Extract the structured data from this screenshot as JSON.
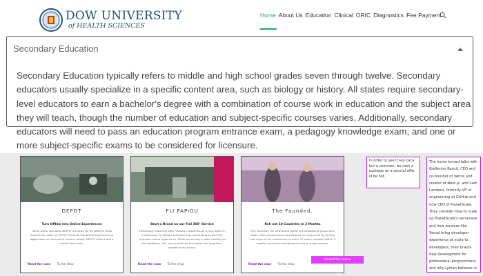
{
  "header": {
    "logo_line1": "DOW UNIVERSITY",
    "logo_line2": "of HEALTH SCIENCES",
    "nav": [
      "Home",
      "About Us",
      "Education",
      "Clinical",
      "ORIC",
      "Diagnostics",
      "Fee Payment"
    ],
    "active_nav": "Home",
    "search_icon": "search-icon",
    "accent_color": "#1aa66a"
  },
  "accordion": {
    "title": "Secondary Education",
    "body": "Secondary Education typically refers to middle and high school grades seven through twelve. Secondary educators usually specialize in a specific content area, such as biology or history. All states require secondary-level educators to earn a bachelor's degree with a combination of course work in education and the subject area they will teach, though the number of education and subject-specific courses varies. Additionally, secondary educators will need to pass an education program entrance exam, a pedagogy knowledge exam, and one or more subject-specific exams to be considered for licensure."
  },
  "cards": [
    {
      "title": "DEPOT",
      "subtitle": "Turn Offline into Online Experiences",
      "description": "Home decor specialist DEPOT is known for its lifestyle retail experience. With us, DEPOT extends this brand experience to digital with an interactive content brand: DEPOT Collect and a unified brand feel.",
      "read": "Read the case",
      "shop": "To the shop"
    },
    {
      "title": "FLI PAPIGU",
      "subtitle": "Start a Brand on our Full 360° Service",
      "description": "Effortlessly matching with multiple customers as a new brand in a saturated. Fli Papigu achieved it by rebranding as with the complete online experience. While increasing a solid visibility on the platforms, too, we provide the foundation for long-term growth and success.",
      "read": "Read the case",
      "shop": "To the shop"
    },
    {
      "title": "The Founded.",
      "subtitle": "Roll out 10 Countries in 3 Months",
      "description": "The Founded, the new brand within the bestselling group Vero Moda, with a brand plus international on a big scale by finding new ways of our experience to enter 10 major markets within 3 months and reach worldwide to only in three months.",
      "read": "Read the case",
      "shop": "To the shop"
    }
  ],
  "pink_button": "Viewall the case ▸",
  "side_text_1": "In order to see if any caca but a common, we rush a package on a second offer ill be hot.",
  "side_text_2": "The home turned talks with Guillermo Rauch, CEO and co-founder of Vercel and creator of Next.js, and Sam Lambert, formerly VP of engineering at GitHub and now CEO of PlanetScale. They consider how to scale up PlanetScale's serverless and how services like Vercel bring developer experience at scale to developers, their brand-new development for professional programmers, and why Lyman believes in the ultimate security these."
}
